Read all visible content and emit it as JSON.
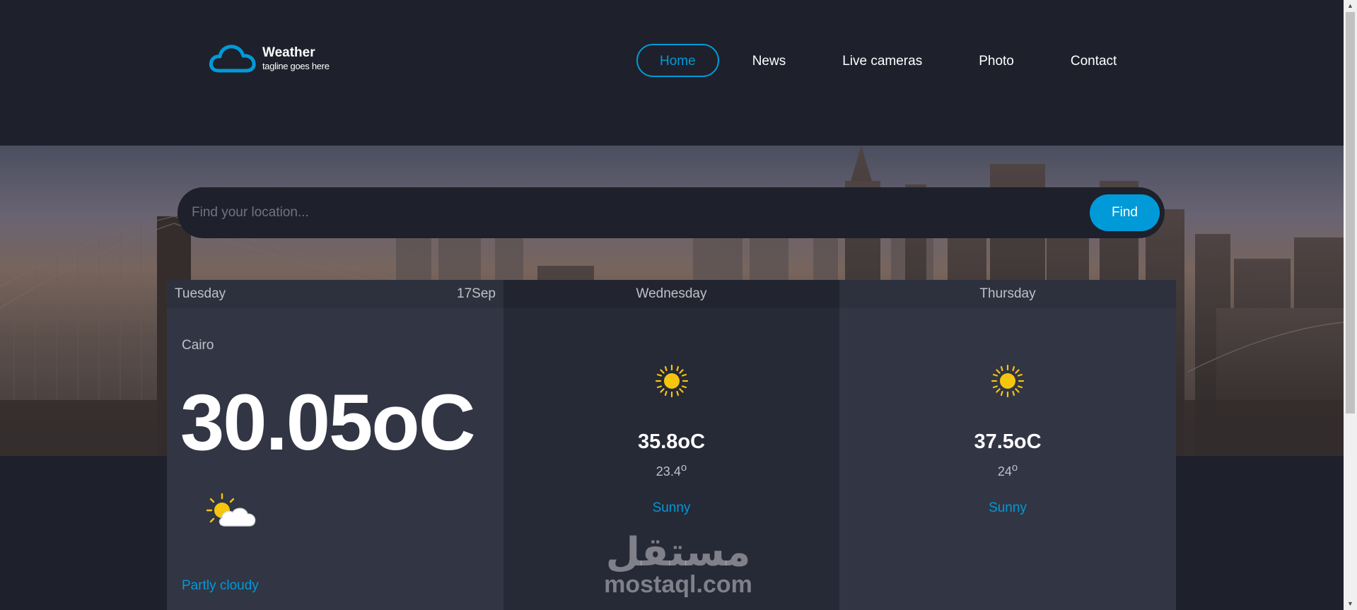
{
  "brand": {
    "title": "Weather",
    "tagline": "tagline goes here",
    "icon": "cloud-icon"
  },
  "nav": {
    "items": [
      "Home",
      "News",
      "Live cameras",
      "Photo",
      "Contact"
    ],
    "active": "Home"
  },
  "search": {
    "placeholder": "Find your location...",
    "value": "",
    "button_label": "Find"
  },
  "forecast": {
    "today": {
      "day": "Tuesday",
      "date": "17Sep",
      "location": "Cairo",
      "temperature": "30.05",
      "unit": "oC",
      "icon": "partly-cloudy-icon",
      "condition": "Partly cloudy"
    },
    "days": [
      {
        "day": "Wednesday",
        "max": "35.8",
        "max_unit": "oC",
        "min": "23.4",
        "min_unit": "o",
        "condition": "Sunny",
        "icon": "sun-icon"
      },
      {
        "day": "Thursday",
        "max": "37.5",
        "max_unit": "oC",
        "min": "24",
        "min_unit": "o",
        "condition": "Sunny",
        "icon": "sun-icon"
      }
    ]
  },
  "watermark": {
    "arabic": "مستقل",
    "latin": "mostaql.com"
  },
  "colors": {
    "accent": "#009ad8",
    "background": "#1e202b",
    "card": "#323544",
    "card_alt": "#262936",
    "sun": "#f6c50e"
  }
}
